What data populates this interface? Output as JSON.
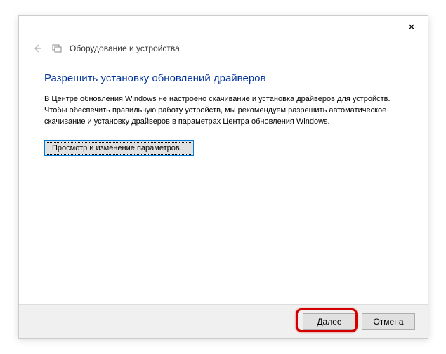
{
  "window": {
    "title": "Оборудование и устройства"
  },
  "content": {
    "heading": "Разрешить установку обновлений драйверов",
    "description": "В Центре обновления Windows не настроено скачивание и установка драйверов для устройств. Чтобы обеспечить правильную работу устройств, мы рекомендуем разрешить автоматическое скачивание и установку драйверов в параметрах Центра обновления Windows.",
    "settings_button": "Просмотр и изменение параметров..."
  },
  "footer": {
    "next": "Далее",
    "cancel": "Отмена"
  },
  "icons": {
    "close": "✕",
    "back": "←"
  }
}
